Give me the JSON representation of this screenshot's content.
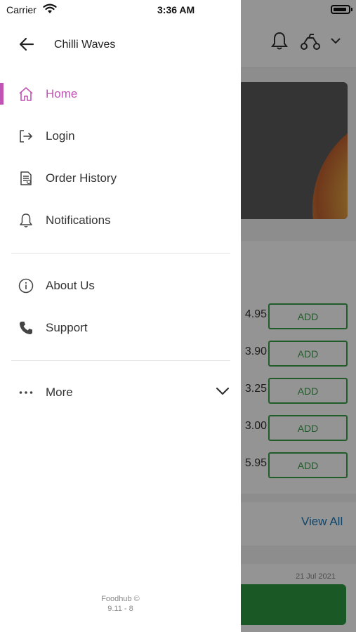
{
  "status_bar": {
    "carrier": "Carrier",
    "time": "3:36 AM"
  },
  "drawer": {
    "title": "Chilli Waves",
    "accent_color": "#c054b4",
    "items": [
      {
        "label": "Home",
        "icon": "home-icon",
        "active": true
      },
      {
        "label": "Login",
        "icon": "login-icon",
        "active": false
      },
      {
        "label": "Order History",
        "icon": "receipt-icon",
        "active": false
      },
      {
        "label": "Notifications",
        "icon": "bell-icon",
        "active": false
      }
    ],
    "secondary_items": [
      {
        "label": "About Us",
        "icon": "info-icon"
      },
      {
        "label": "Support",
        "icon": "phone-icon"
      }
    ],
    "more_label": "More",
    "footer_brand": "Foodhub ©",
    "footer_version": "9.11 - 8"
  },
  "background": {
    "prices": [
      "4.95",
      "3.90",
      "3.25",
      "3.00",
      "5.95"
    ],
    "add_label": "ADD",
    "add_color": "#3aa04a",
    "view_all": "View All",
    "date": "21 Jul 2021"
  }
}
